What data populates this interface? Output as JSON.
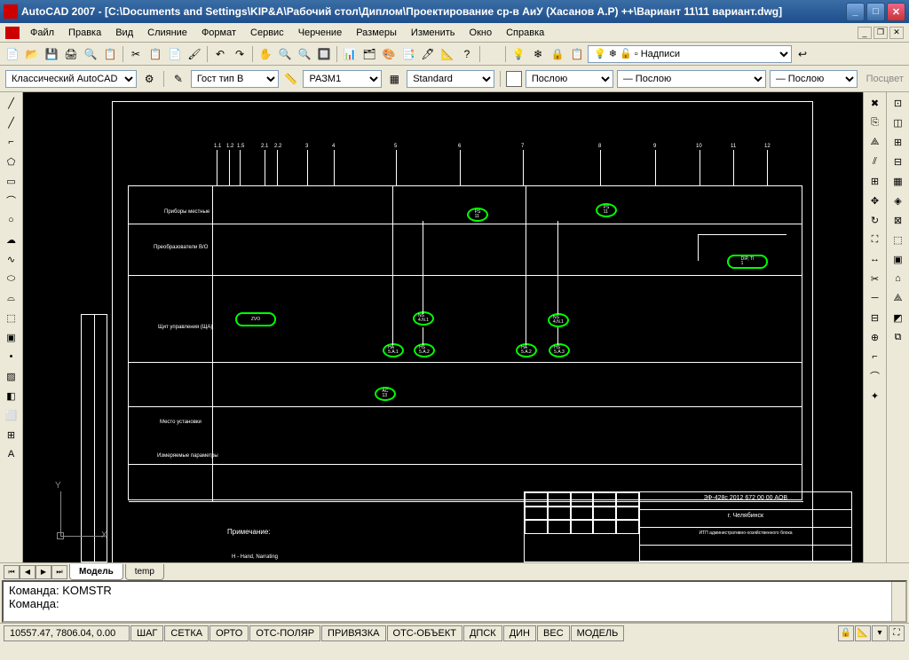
{
  "title": "AutoCAD 2007 - [C:\\Documents and Settings\\KIP&A\\Рабочий стол\\Диплом\\Проектирование ср-в АиУ (Хасанов А.Р) ++\\Вариант 11\\11 вариант.dwg]",
  "menu": {
    "file": "Файл",
    "edit": "Правка",
    "view": "Вид",
    "merge": "Слияние",
    "format": "Формат",
    "service": "Сервис",
    "draw": "Черчение",
    "dims": "Размеры",
    "modify": "Изменить",
    "window": "Окно",
    "help": "Справка"
  },
  "layer_panel_label": "Надписи",
  "props": {
    "workspace": "Классический AutoCAD",
    "textstyle": "Гост тип В",
    "dimstyle": "РАЗМ1",
    "tablestyle": "Standard",
    "color": "Послою",
    "linetype": "— Послою",
    "lineweight": "— Послою",
    "plot": "Посцвет"
  },
  "tabs": {
    "model": "Модель",
    "temp": "temp"
  },
  "cmd": {
    "line1": "Команда: KOMSTR",
    "line2": "Команда:"
  },
  "status": {
    "coords": "10557.47, 7806.04, 0.00",
    "shag": "ШАГ",
    "setka": "СЕТКА",
    "orto": "ОРТО",
    "otspol": "ОТС-ПОЛЯР",
    "priv": "ПРИВЯЗКА",
    "otsobj": "ОТС-ОБЪЕКТ",
    "dpsk": "ДПСК",
    "din": "ДИН",
    "ves": "ВЕС",
    "model": "МОДЕЛЬ"
  },
  "drawing": {
    "ticks": [
      "1.1",
      "1.2",
      "1.5",
      "2.1",
      "2.2",
      "3",
      "4",
      "5",
      "6",
      "7",
      "8",
      "9",
      "10",
      "11",
      "12"
    ],
    "row1": "Приборы местные",
    "row2": "Преобразователи\nВ/О",
    "row3": "Щит управления\n(ЩА)",
    "row4": "Место установки",
    "row5": "Измеряемые\nпараметры",
    "titleblock_code": "ЗФ-428с 2012 672 00 00 АОВ",
    "city": "г. Челябинск",
    "obj": "ИТП административно-хозяйственного блока",
    "legend": "Примечание:",
    "leg1": "H - Hand, Narrating"
  }
}
